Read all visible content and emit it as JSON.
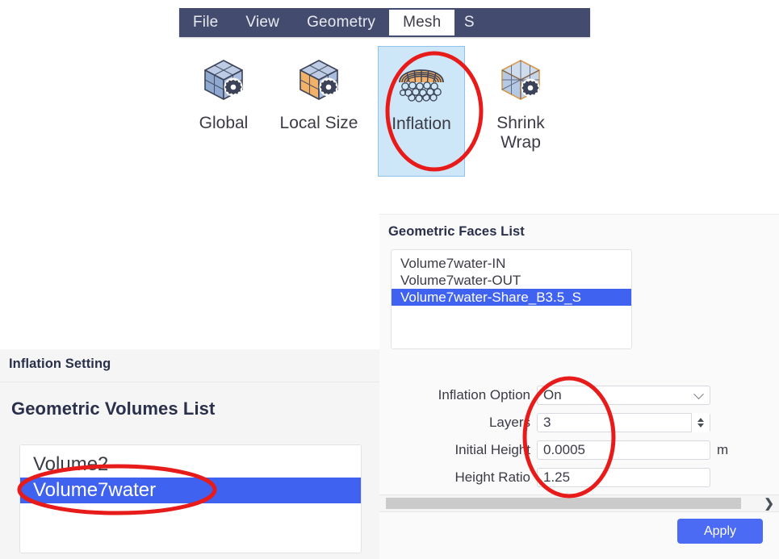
{
  "menubar": {
    "items": [
      {
        "label": "File",
        "active": false
      },
      {
        "label": "View",
        "active": false
      },
      {
        "label": "Geometry",
        "active": false
      },
      {
        "label": "Mesh",
        "active": true
      },
      {
        "label": "S",
        "active": false
      }
    ]
  },
  "toolbar": {
    "buttons": [
      {
        "label": "Global",
        "icon": "cube-gear-blue-icon",
        "selected": false
      },
      {
        "label": "Local Size",
        "icon": "cube-gear-orange-icon",
        "selected": false
      },
      {
        "label": "Inflation",
        "icon": "inflation-layers-icon",
        "selected": true
      },
      {
        "label": "Shrink Wrap",
        "icon": "wireframe-cube-gear-icon",
        "selected": false
      }
    ]
  },
  "faces_panel": {
    "title": "Geometric Faces List",
    "items": [
      {
        "label": "Volume7water-IN",
        "selected": false
      },
      {
        "label": "Volume7water-OUT",
        "selected": false
      },
      {
        "label": "Volume7water-Share_B3.5_S",
        "selected": true
      }
    ]
  },
  "inflation_panel": {
    "header_title": "Inflation Setting",
    "volumes_title": "Geometric Volumes List",
    "volumes": [
      {
        "label": "Volume2",
        "selected": false
      },
      {
        "label": "Volume7water",
        "selected": true
      }
    ]
  },
  "form": {
    "inflation_option": {
      "label": "Inflation Option",
      "value": "On"
    },
    "layers": {
      "label": "Layers",
      "value": "3"
    },
    "initial_height": {
      "label": "Initial Height",
      "value": "0.0005",
      "unit": "m"
    },
    "height_ratio": {
      "label": "Height Ratio",
      "value": "1.25"
    }
  },
  "scrollbar": {
    "arrow": "❯"
  },
  "apply": {
    "label": "Apply"
  },
  "colors": {
    "menubar_bg": "#434c6e",
    "selection_blue": "#4062f0",
    "accent_button": "#4c6bf5",
    "tool_selected_bg": "#cee7f8",
    "annotation_red": "#e81b1b",
    "panel_bg": "#f5f5f5"
  }
}
